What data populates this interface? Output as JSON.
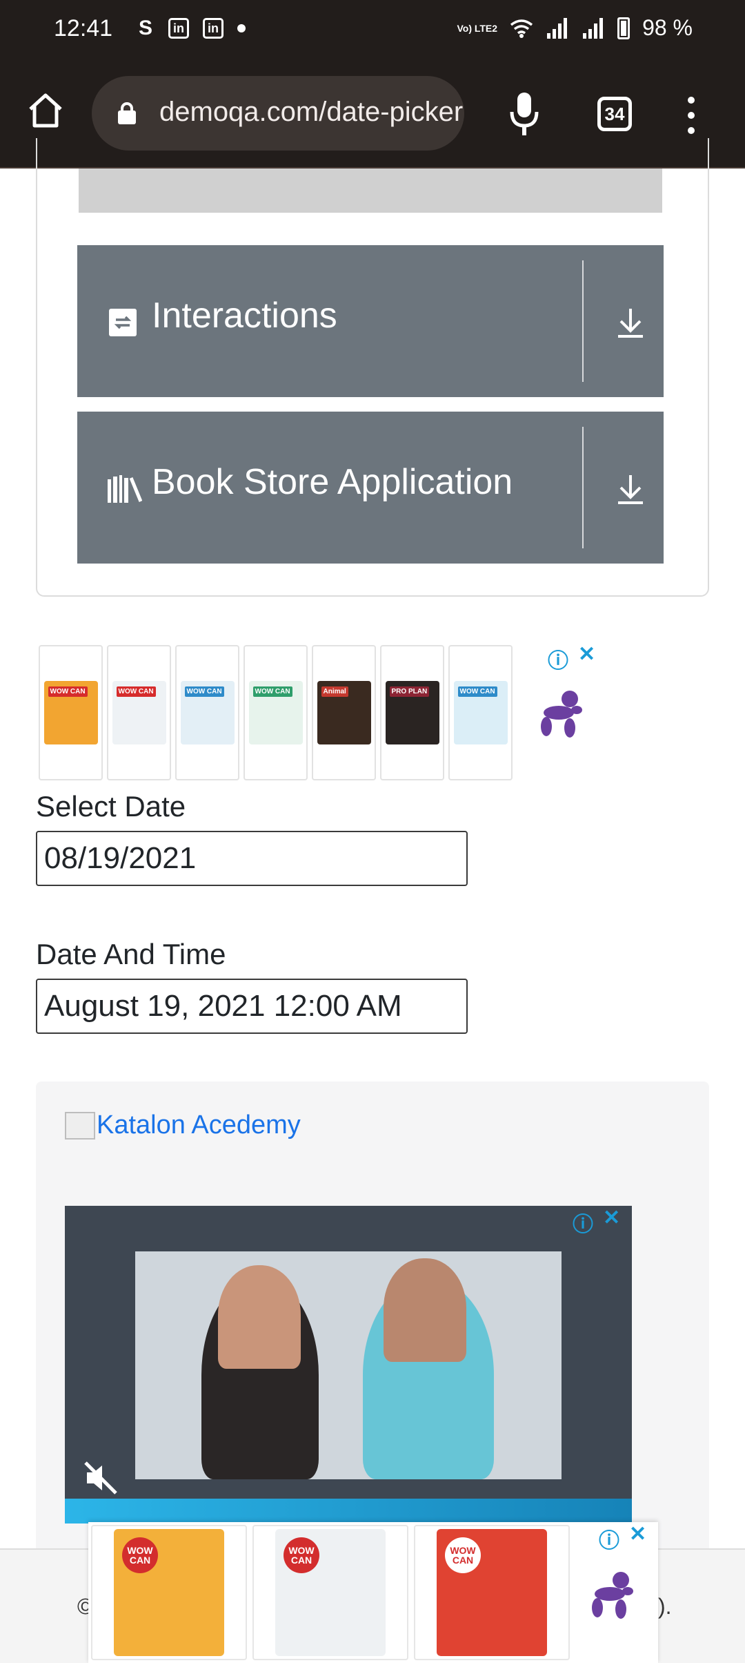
{
  "status_bar": {
    "time": "12:41",
    "battery": "98 %",
    "network_label": "Vo) LTE2",
    "icons": [
      "s-icon",
      "linkedin-icon",
      "linkedin-icon",
      "dot-icon",
      "wifi-icon",
      "signal-icon",
      "signal-icon",
      "battery-icon"
    ]
  },
  "browser": {
    "url": "demoqa.com/date-picker",
    "tab_count": "34"
  },
  "sidebar": {
    "items": [
      {
        "label": "Interactions",
        "icon": "interactions-icon"
      },
      {
        "label": "Book Store Application",
        "icon": "book-store-icon"
      }
    ]
  },
  "form": {
    "select_date_label": "Select Date",
    "select_date_value": "08/19/2021",
    "date_time_label": "Date And Time",
    "date_time_value": "August 19, 2021 12:00 AM"
  },
  "banner": {
    "link_text": "Katalon Acedemy"
  },
  "footer": {
    "left_text": "©",
    "right_text": ")."
  },
  "colors": {
    "status_bg": "#221d1b",
    "accordion_bg": "#6c757d",
    "link": "#1a73e8",
    "ad_choice": "#1a9bd7",
    "balloon": "#6b3fa0"
  }
}
